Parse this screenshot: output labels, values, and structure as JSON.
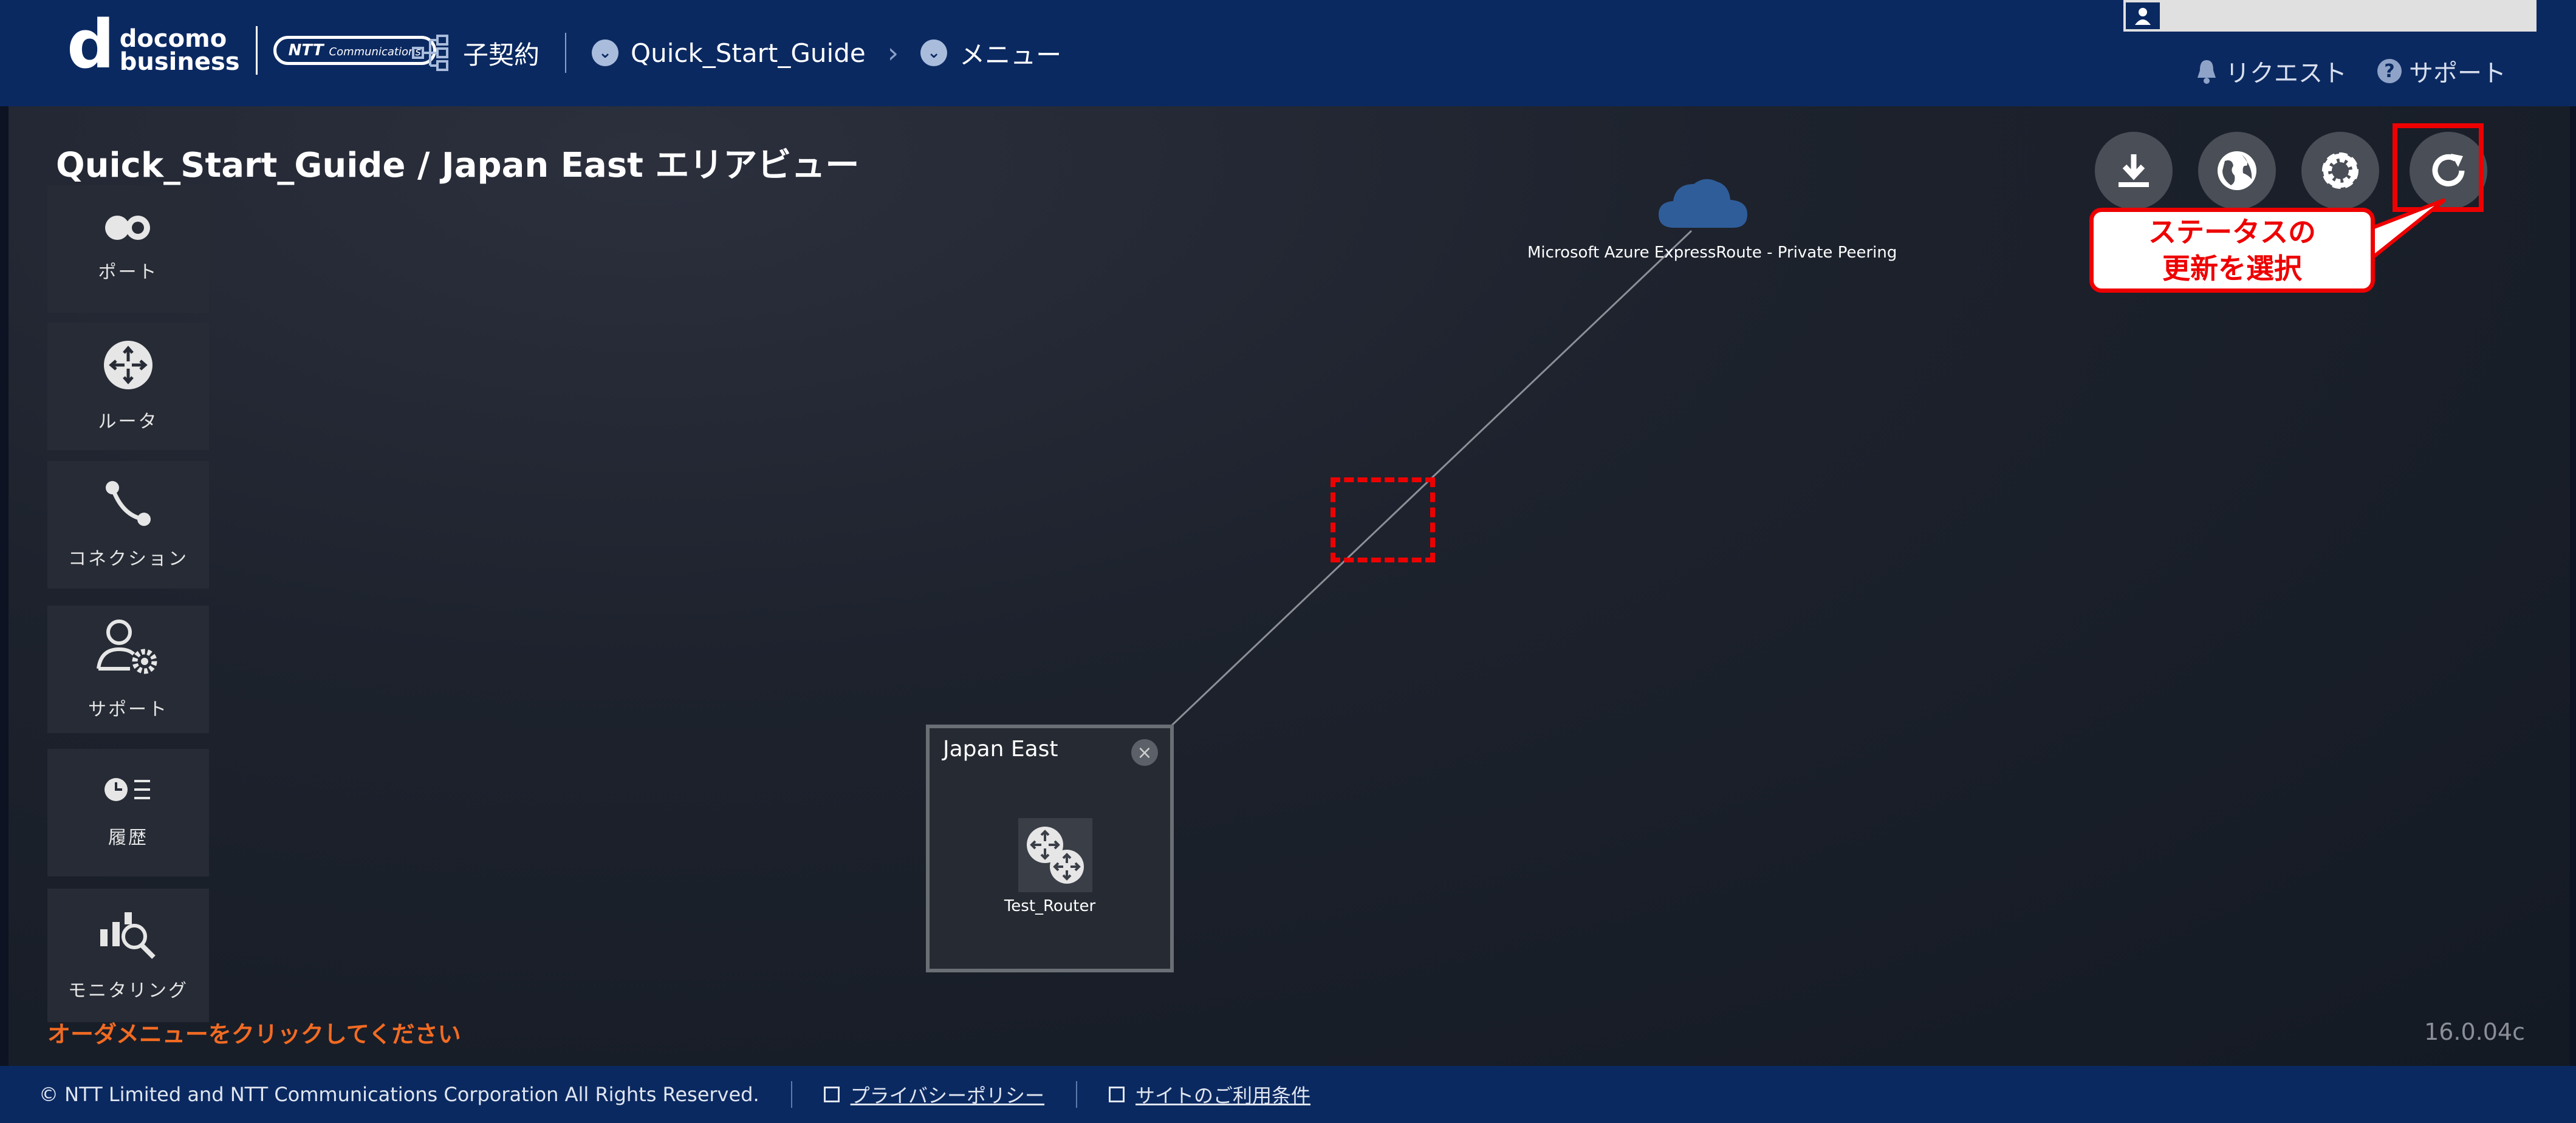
{
  "header": {
    "logo_text_line1": "docomo",
    "logo_text_line2": "business",
    "ntt_badge": "NTT",
    "ntt_badge_small": "Communications",
    "contract_label": "子契約",
    "breadcrumb_project": "Quick_Start_Guide",
    "breadcrumb_menu": "メニュー",
    "request_link": "リクエスト",
    "support_link": "サポート"
  },
  "main": {
    "page_title": "Quick_Start_Guide / Japan East エリアビュー",
    "sidebar": [
      {
        "label": "ポート"
      },
      {
        "label": "ルータ"
      },
      {
        "label": "コネクション"
      },
      {
        "label": "サポート"
      },
      {
        "label": "履歴"
      },
      {
        "label": "モニタリング"
      }
    ],
    "cloud_label": "Microsoft Azure ExpressRoute - Private Peering",
    "area_title": "Japan East",
    "router_label": "Test_Router",
    "callout_line1": "ステータスの",
    "callout_line2": "更新を選択",
    "hint": "オーダメニューをクリックしてください",
    "version": "16.0.04c"
  },
  "footer": {
    "copyright": "© NTT Limited and NTT Communications Corporation All Rights Reserved.",
    "privacy": "プライバシーポリシー",
    "terms": "サイトのご利用条件"
  },
  "colors": {
    "header_bg": "#0b2961",
    "annotation_red": "#e00",
    "hint_orange": "#f26b22"
  }
}
